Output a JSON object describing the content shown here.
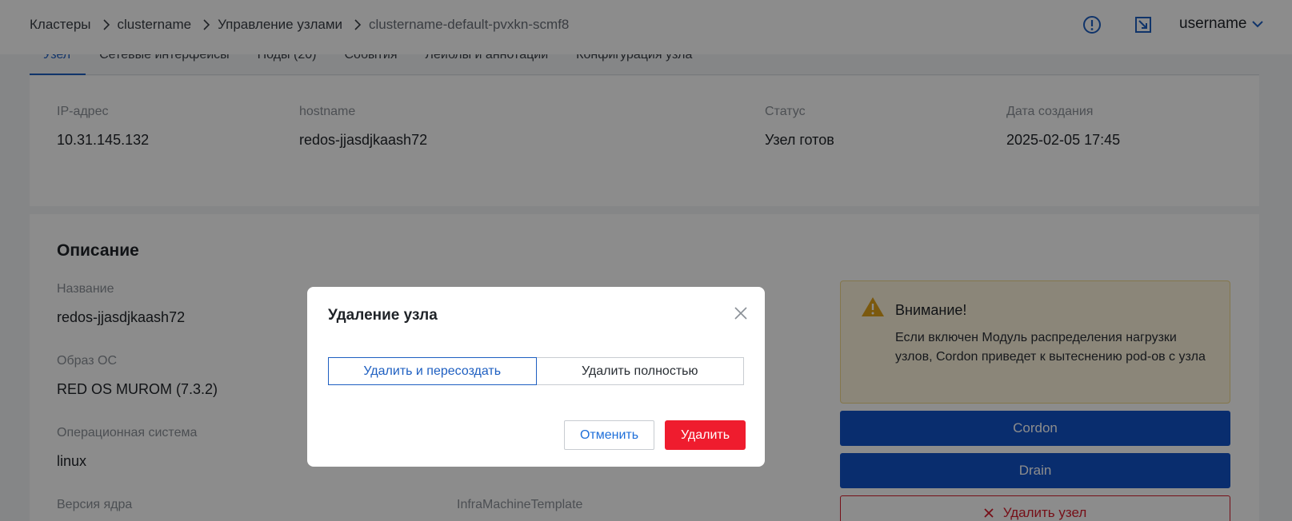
{
  "header": {
    "breadcrumb": [
      "Кластеры",
      "clustername",
      "Управление узлами",
      "clustername-default-pvxkn-scmf8"
    ],
    "user_name": "username"
  },
  "tabs": [
    "Узел",
    "Сетевые интерфейсы",
    "Поды (20)",
    "События",
    "Лейблы и аннотации",
    "Конфигурация узла"
  ],
  "summary": {
    "ip_label": "IP-адрес",
    "ip_value": "10.31.145.132",
    "hostname_label": "hostname",
    "hostname_value": "redos-jjasdjkaash72",
    "status_label": "Статус",
    "status_value": "Узел готов",
    "created_label": "Дата создания",
    "created_value": "2025-02-05 17:45"
  },
  "description": {
    "title": "Описание",
    "name_label": "Название",
    "name_value": "redos-jjasdjkaash72",
    "os_image_label": "Образ ОС",
    "os_image_value": "RED OS MUROM (7.3.2)",
    "os_label": "Операционная система",
    "os_value": "linux",
    "kernel_label": "Версия ядра",
    "infra_label": "InfraMachineTemplate"
  },
  "warning": {
    "title": "Внимание!",
    "text": "Если включен Модуль распределения нагрузки узлов, Cordon приведет к вытеснению pod-ов с узла"
  },
  "actions": {
    "cordon": "Cordon",
    "drain": "Drain",
    "delete_node": "Удалить узел"
  },
  "modal": {
    "title": "Удаление узла",
    "option_recreate": "Удалить и пересоздать",
    "option_full": "Удалить полностью",
    "cancel": "Отменить",
    "delete": "Удалить"
  },
  "colors": {
    "accent": "#1e5fc1",
    "primary_button": "#1252c8",
    "danger": "#ef1c2e",
    "warning_bg": "#fdf4dc",
    "warning_icon": "#e0a21a"
  }
}
